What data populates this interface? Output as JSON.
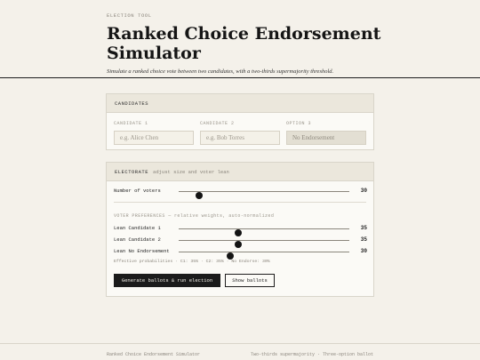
{
  "header": {
    "eyebrow": "ELECTION TOOL",
    "title": "Ranked Choice Endorsement Simulator",
    "subtitle": "Simulate a ranked choice vote between two candidates, with a two-thirds supermajority threshold."
  },
  "candidates": {
    "heading": "CANDIDATES",
    "fields": [
      {
        "label": "CANDIDATE 1",
        "placeholder": "e.g. Alice Chen",
        "value": ""
      },
      {
        "label": "CANDIDATE 2",
        "placeholder": "e.g. Bob Torres",
        "value": ""
      },
      {
        "label": "OPTION 3",
        "placeholder": "",
        "value": "No Endorsement"
      }
    ]
  },
  "electorate": {
    "heading": "ELECTORATE",
    "hint": "adjust size and voter lean",
    "voters": {
      "label": "Number of voters",
      "value": "30",
      "fraction": 0.12
    },
    "preferences_label": "VOTER PREFERENCES — relative weights, auto-normalized",
    "leans": [
      {
        "label": "Lean Candidate 1",
        "value": "35",
        "fraction": 0.35
      },
      {
        "label": "Lean Candidate 2",
        "value": "35",
        "fraction": 0.35
      },
      {
        "label": "Lean No Endorsement",
        "value": "30",
        "fraction": 0.3
      }
    ],
    "effective": "Effective probabilities · C1: 35% · C2: 35% · No Endorse: 30%",
    "run_button": "Generate ballots & run election",
    "show_button": "Show ballots"
  },
  "footer": {
    "left": "Ranked Choice Endorsement Simulator",
    "right": "Two-thirds supermajority · Three-option ballot"
  }
}
